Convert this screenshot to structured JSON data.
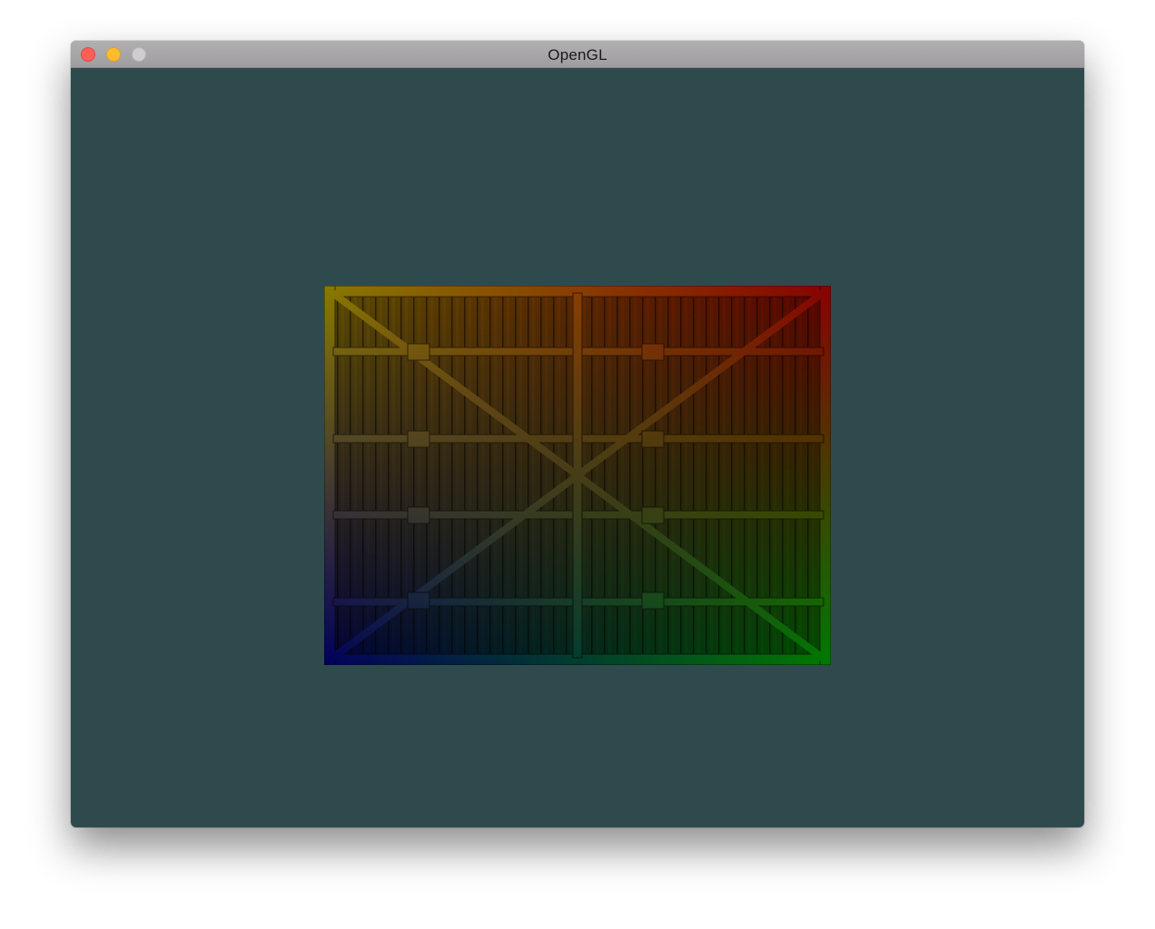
{
  "window": {
    "title": "OpenGL",
    "buttons": {
      "close": "close-button",
      "minimize": "minimize-button",
      "zoom": "zoom-button"
    }
  },
  "scene": {
    "clear_color": "#2f4a4d",
    "texture": "wooden-container",
    "corner_colors": {
      "top_left": "#ffff00",
      "top_right": "#ff0000",
      "bottom_right": "#00ff00",
      "bottom_left": "#0000ff"
    }
  }
}
